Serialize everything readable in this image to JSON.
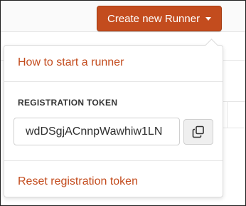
{
  "header": {
    "create_button_label": "Create new Runner",
    "create_button_color": "#c34c1e"
  },
  "dropdown": {
    "help_link": "How to start a runner",
    "token_section_label": "REGISTRATION TOKEN",
    "token_value": "wdDSgjACnnpWawhiw1LN",
    "copy_icon": "copy-icon",
    "reset_link": "Reset registration token"
  }
}
